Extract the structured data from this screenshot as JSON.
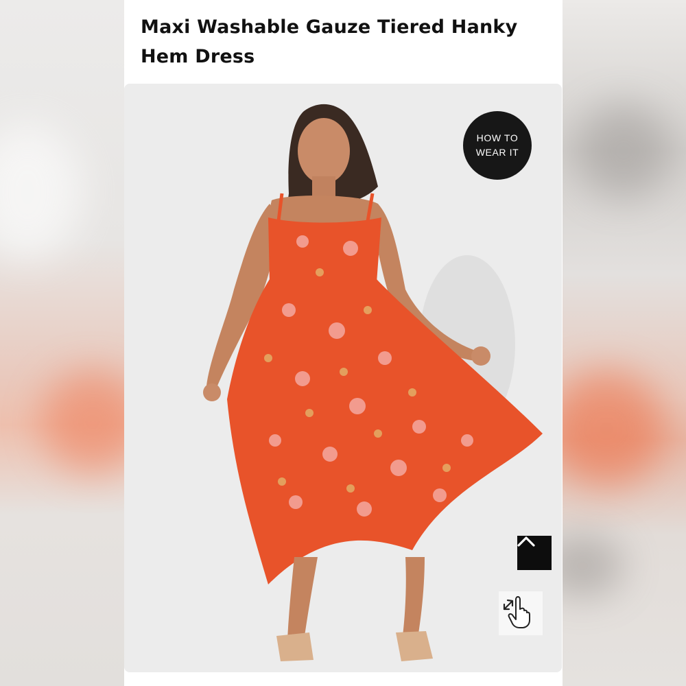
{
  "product": {
    "title": "Maxi Washable Gauze Tiered Hanky Hem Dress"
  },
  "image": {
    "alt": "Model wearing orange floral maxi dress",
    "dress_color": "#e8532a",
    "background_color": "#ececec"
  },
  "badge": {
    "line1": "HOW TO",
    "line2": "WEAR IT"
  },
  "controls": {
    "scroll_top_icon": "chevron-up-icon",
    "zoom_icon": "hand-pointer-expand-icon"
  }
}
